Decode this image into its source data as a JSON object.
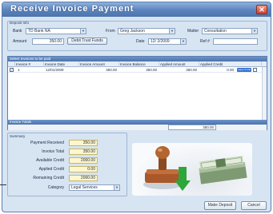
{
  "window": {
    "title": "Receive Invoice Payment",
    "close_glyph": "✕"
  },
  "deposit": {
    "group_label": "Deposit Info",
    "bank_label": "Bank",
    "bank_value": "TD Bank NA",
    "from_label": "From",
    "from_value": "Greg Jackson",
    "matter_label": "Matter",
    "matter_value": "Consultation",
    "amount_label": "Amount",
    "amount_value": "350.00",
    "debit_button": "Debit Trust Funds",
    "date_label": "Date",
    "date_value": "12/ 2/2009",
    "ref_label": "Ref #",
    "ref_value": ""
  },
  "grid": {
    "title": "Select Invoices to be paid",
    "columns": [
      "Invoice #",
      "Invoice Date",
      "Invoice Amount",
      "Invoice Balance",
      "Applied Amount",
      "Applied Credit"
    ],
    "rows": [
      {
        "checked": "✓",
        "invoice": "1",
        "date": "12/01/2009",
        "amount": "350.00",
        "balance": "350.00",
        "applied": "350.00",
        "credit": "0.00",
        "action": "Apply Credit"
      }
    ],
    "totals_label": "Invoice Totals",
    "totals_value": "350.00"
  },
  "summary": {
    "group_label": "Summary",
    "items": [
      {
        "label": "Payment Received",
        "value": "350.00"
      },
      {
        "label": "Invoice Total",
        "value": "350.00"
      },
      {
        "label": "Available Credit",
        "value": "2000.00"
      },
      {
        "label": "Applied Credit",
        "value": "0.00"
      },
      {
        "label": "Remaining Credit",
        "value": "2000.00"
      }
    ],
    "category_label": "Category",
    "category_value": "Legal Services"
  },
  "buttons": {
    "make_deposit": "Make Deposit",
    "cancel": "Cancel"
  },
  "colors": {
    "accent": "#4b74ad",
    "window_bg": "#d7e4f2",
    "summary_field": "#fff6cf",
    "arrow": "#2ea63a"
  }
}
